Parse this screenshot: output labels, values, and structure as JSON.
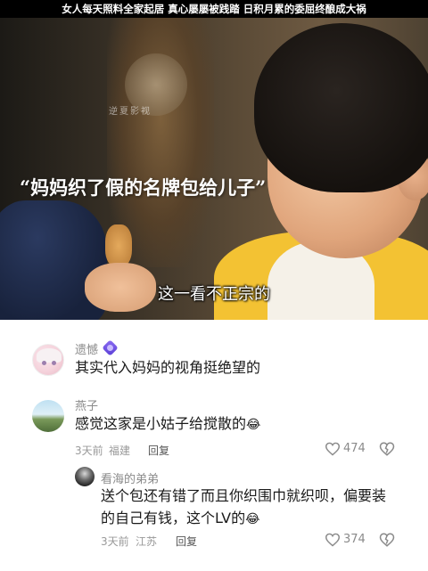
{
  "banner": {
    "text": "女人每天照料全家起居  真心屡屡被践踏  日积月累的委屈终酿成大祸"
  },
  "video": {
    "watermark": "逆夏影视",
    "quote": "“妈妈织了假的名牌包给儿子”",
    "subtitle": "这一看不正宗的"
  },
  "comments": [
    {
      "username": "遗憾",
      "text": "其实代入妈妈的视角挺绝望的",
      "badge_color": "#7b5cf0"
    },
    {
      "username": "燕子",
      "text": "感觉这家是小姑子给搅散的",
      "emoji": "😂",
      "time": "3天前",
      "location": "福建",
      "reply_label": "回复",
      "likes": "474"
    },
    {
      "username": "看海的弟弟",
      "text": "送个包还有错了而且你织围巾就织呗，偏要装的自己有钱，这个LV的",
      "emoji": "😂",
      "time": "3天前",
      "location": "江苏",
      "reply_label": "回复",
      "likes": "374"
    }
  ],
  "icons": {
    "heart": "heart-outline-icon",
    "dislike": "dislike-heart-icon"
  }
}
